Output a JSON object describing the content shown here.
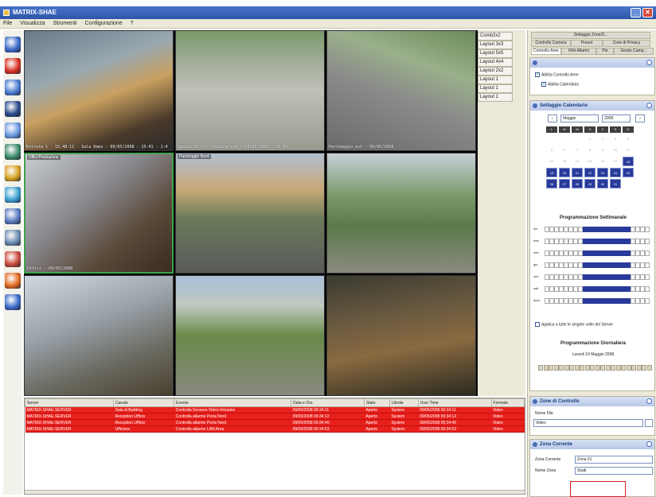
{
  "window": {
    "title": "MATRIX-SHAE"
  },
  "menu": {
    "items": [
      "File",
      "Visualizza",
      "Strumenti",
      "Configurazione",
      "?"
    ]
  },
  "toolbar": {
    "tools": [
      {
        "icon": "cameras-icon",
        "color": "#3a6ac8"
      },
      {
        "icon": "alarm-icon",
        "color": "#d83020"
      },
      {
        "icon": "monitor-icon",
        "color": "#4a7ad0"
      },
      {
        "icon": "disk-icon",
        "color": "#2a4a8a"
      },
      {
        "icon": "network-icon",
        "color": "#6a9ae0"
      },
      {
        "icon": "globe-icon",
        "color": "#3a8a6a"
      },
      {
        "icon": "pen-icon",
        "color": "#d8a020"
      },
      {
        "icon": "clock-icon",
        "color": "#3aa0d0"
      },
      {
        "icon": "users-icon",
        "color": "#5a7ac0"
      },
      {
        "icon": "tree-icon",
        "color": "#6a8ab0"
      },
      {
        "icon": "chart-icon",
        "color": "#c84a3a"
      },
      {
        "icon": "palette-icon",
        "color": "#e06a20"
      },
      {
        "icon": "search-icon",
        "color": "#3a6ac8"
      }
    ]
  },
  "cameras": [
    {
      "tag": "",
      "caption": "Entrata 1 - 15.48.11 - Sala Demo - 09/05/2008 - 15:41 - 1:4",
      "scene": "office"
    },
    {
      "tag": "",
      "caption": "Spazio 15 lt - Sala alarm - 09/05/2008 - 15:41",
      "scene": "parking-empty"
    },
    {
      "tag": "",
      "caption": "Parcheggio est - 09/05/2008",
      "scene": "parking-road"
    },
    {
      "tag": "Uffici Produzione",
      "caption": "Uffici - 09/05/2008",
      "scene": "room",
      "selected": true
    },
    {
      "tag": "Parcheggio Nord",
      "caption": "",
      "scene": "parking-cars"
    },
    {
      "tag": "",
      "caption": "",
      "scene": "gate"
    },
    {
      "tag": "",
      "caption": "",
      "scene": "corridor"
    },
    {
      "tag": "",
      "caption": "",
      "scene": "canopy"
    },
    {
      "tag": "",
      "caption": "",
      "scene": "desk"
    }
  ],
  "layouts": [
    "Comb2x2",
    "Layout 3x3",
    "Layout 5x5",
    "Layout 4x4",
    "Layout 2x2",
    "Layout 1",
    "Layout 1",
    "Layout 1"
  ],
  "events": {
    "columns": [
      "Server",
      "Canale",
      "Evento",
      "Data e Ora",
      "Stato",
      "Utente",
      "User Time",
      "Formato"
    ],
    "rows": [
      [
        "MATRIX-SHAE-SERVER",
        "Sala di Building",
        "Controlla Sensore Video Intrusion",
        "09/05/2008 09:34:11",
        "Aperto",
        "System",
        "09/05/2008 09:34:11",
        "Video"
      ],
      [
        "MATRIX-SHAE-SERVER",
        "Reception Ufficio",
        "Controlla allarme Porta Nord",
        "09/05/2008 09:34:12",
        "Aperto",
        "System",
        "09/05/2008 09:34:12",
        "Video"
      ],
      [
        "MATRIX-SHAE-SERVER",
        "Reception Ufficio",
        "Controlla allarme Porta Nord",
        "09/05/2008 09:34:40",
        "Aperto",
        "System",
        "09/05/2008 09:34:40",
        "Video"
      ],
      [
        "MATRIX-SHAE-SERVER",
        "Ufficioss",
        "Controlla allarme LAN Area",
        "09/05/2008 09:34:53",
        "Aperto",
        "System",
        "09/05/2008 09:34:53",
        "Video"
      ]
    ]
  },
  "panel": {
    "top_button": "Settaggio Zone/S...",
    "tabs_row1": [
      "Controllo Camera",
      "Preset",
      "Zone di Privacy"
    ],
    "tabs_row2": [
      "Controllo Aree",
      "Filtri Allarmi",
      "Ptz",
      "Gestio Camp..."
    ],
    "checks": [
      {
        "label": "Abilita Controllo Aree",
        "checked": true
      },
      {
        "label": "Abilita Calendario",
        "checked": true
      }
    ],
    "calendar": {
      "title": "Settaggio Calendario",
      "month": "Maggio",
      "year": "2008",
      "weekdays": [
        "L",
        "M",
        "M",
        "G",
        "V",
        "S",
        "D"
      ],
      "days": [
        "",
        "",
        "",
        "1",
        "2",
        "3",
        "4",
        "5",
        "6",
        "7",
        "8",
        "9",
        "10",
        "11",
        "12",
        "13",
        "14",
        "15",
        "16",
        "17",
        "18",
        "19",
        "20",
        "21",
        "22",
        "23",
        "24",
        "25",
        "26",
        "27",
        "28",
        "29",
        "30",
        "31"
      ],
      "marked_from": 18
    },
    "weekly": {
      "title": "Programmazione Settimanale",
      "days": [
        "lun",
        "mar",
        "mer",
        "gio",
        "ven",
        "sab",
        "dom"
      ],
      "apply_label": "Applica a tutte le singole celle del Server"
    },
    "daily": {
      "title": "Programmazione Giornaliera",
      "date": "Lunedi 19 Maggio 2008"
    },
    "zone": {
      "title": "Zone di Controllo",
      "nome_file_label": "Nome File",
      "nome_file_value": "Video"
    },
    "zona": {
      "title": "Zona Corrente",
      "current_label": "Zona Corrente",
      "current_value": "Zona 01",
      "name_label": "Nome Zona",
      "name_value": "Studi"
    }
  }
}
